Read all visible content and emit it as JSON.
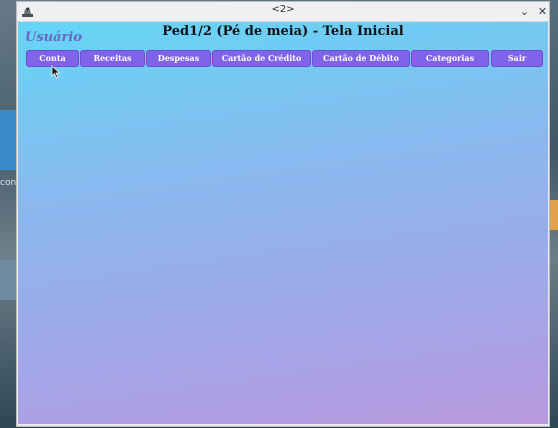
{
  "window": {
    "title": "<2>",
    "minimize_glyph": "⌄",
    "close_glyph": "✕",
    "app_icon": "java-app-icon"
  },
  "app": {
    "user_label": "Usuário",
    "page_title": "Ped1/2 (Pé de meia) - Tela Inicial"
  },
  "nav": {
    "buttons": [
      {
        "id": "conta",
        "label": "Conta"
      },
      {
        "id": "receitas",
        "label": "Receitas"
      },
      {
        "id": "despesas",
        "label": "Despesas"
      },
      {
        "id": "cartao-credito",
        "label": "Cartão de Crédito"
      },
      {
        "id": "cartao-debito",
        "label": "Cartão de Débito"
      },
      {
        "id": "categorias",
        "label": "Categorias"
      },
      {
        "id": "sair",
        "label": "Sair"
      }
    ]
  },
  "desktop": {
    "partial_text": "conte"
  },
  "colors": {
    "nav_button": "#7f63e8",
    "user_label": "#6a67c2",
    "gradient_top": "#64d6f6",
    "gradient_bottom": "#b898dd"
  }
}
